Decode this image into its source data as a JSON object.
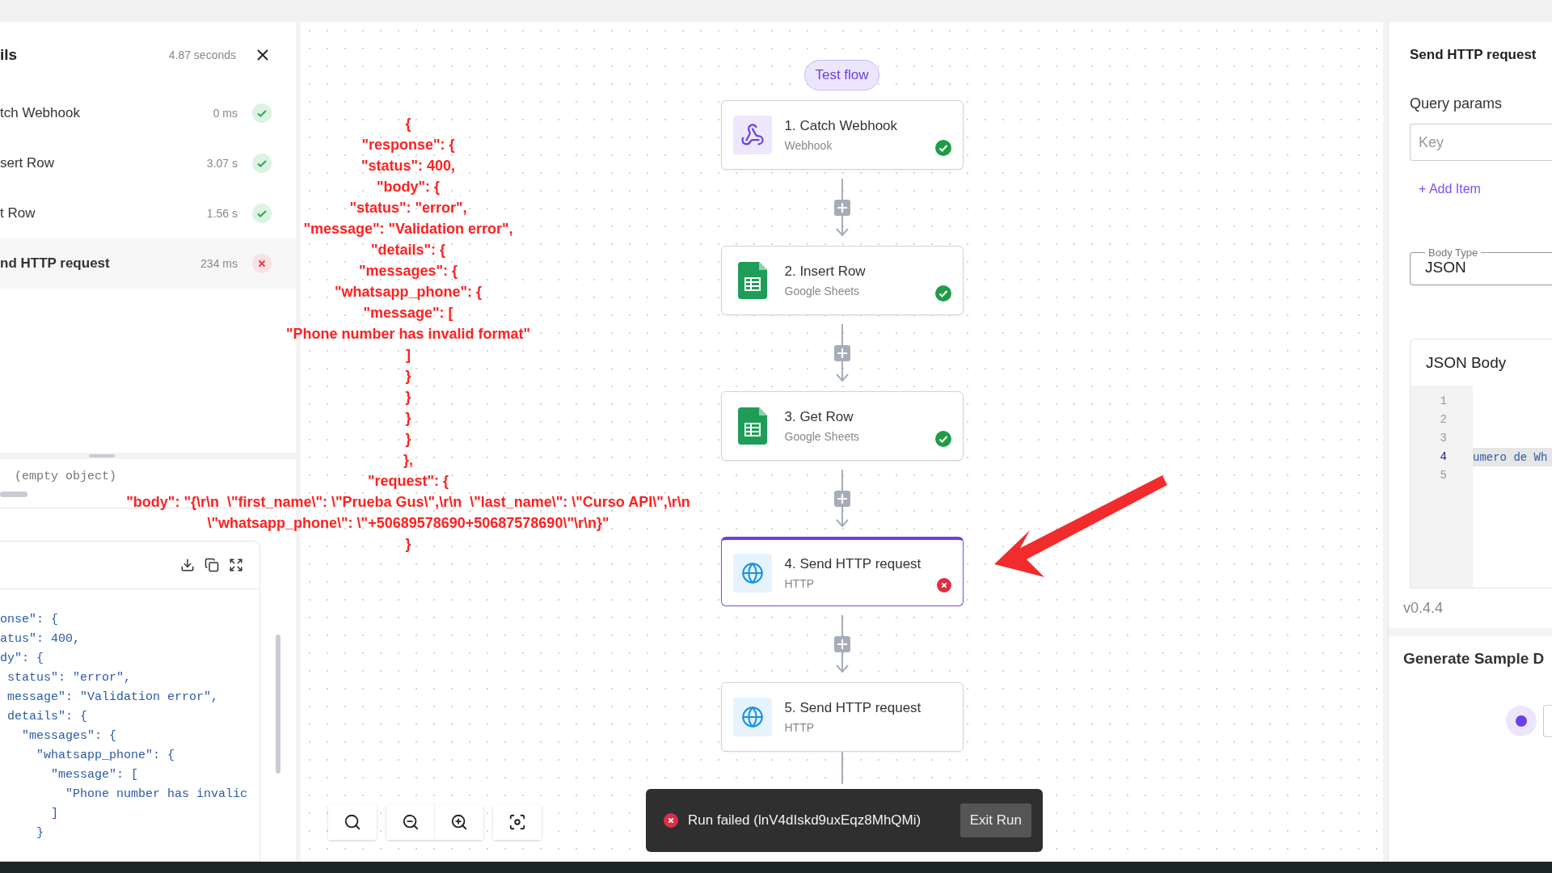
{
  "run_details": {
    "title": "ils",
    "duration": "4.87 seconds",
    "steps": [
      {
        "name": "tch Webhook",
        "time": "0 ms",
        "failed": false,
        "selected": false
      },
      {
        "name": "sert Row",
        "time": "3.07 s",
        "failed": false,
        "selected": false
      },
      {
        "name": "t Row",
        "time": "1.56 s",
        "failed": false,
        "selected": false
      },
      {
        "name": "nd HTTP request",
        "time": "234 ms",
        "failed": true,
        "selected": true
      }
    ],
    "input_preview": "(empty object)",
    "output_lines": [
      "onse\": {",
      "atus\": 400,",
      "dy\": {",
      " status\": \"error\",",
      " message\": \"Validation error\",",
      " details\": {",
      "   \"messages\": {",
      "     \"whatsapp_phone\": {",
      "       \"message\": [",
      "         \"Phone number has invalic",
      "       ]",
      "     }"
    ]
  },
  "canvas": {
    "test_button": "Test flow",
    "nodes": [
      {
        "title": "1. Catch Webhook",
        "subtitle": "Webhook",
        "kind": "webhook",
        "passed": true,
        "failed": false,
        "selected": false
      },
      {
        "title": "2. Insert Row",
        "subtitle": "Google Sheets",
        "kind": "sheets",
        "passed": true,
        "failed": false,
        "selected": false
      },
      {
        "title": "3. Get Row",
        "subtitle": "Google Sheets",
        "kind": "sheets",
        "passed": true,
        "failed": false,
        "selected": false
      },
      {
        "title": "4. Send HTTP request",
        "subtitle": "HTTP",
        "kind": "http",
        "passed": false,
        "failed": true,
        "selected": true
      },
      {
        "title": "5. Send HTTP request",
        "subtitle": "HTTP",
        "kind": "http",
        "passed": false,
        "failed": false,
        "selected": false
      }
    ],
    "toast": {
      "message": "Run failed (lnV4dIskd9uxEqz8MhQMi)",
      "button": "Exit Run"
    }
  },
  "annotation": {
    "lines": [
      "{",
      "\"response\": {",
      "\"status\": 400,",
      "\"body\": {",
      "\"status\": \"error\",",
      "\"message\": \"Validation error\",",
      "\"details\": {",
      "\"messages\": {",
      "\"whatsapp_phone\": {",
      "\"message\": [",
      "\"Phone number has invalid format\"",
      "]",
      "}",
      "}",
      "}",
      "}",
      "},",
      "\"request\": {",
      "\"body\": \"{\\r\\n  \\\"first_name\\\": \\\"Prueba Gus\\\",\\r\\n  \\\"last_name\\\": \\\"Curso API\\\",\\r\\n",
      "\\\"whatsapp_phone\\\": \\\"+50689578690+50687578690\\\"\\r\\n}\"",
      "}"
    ]
  },
  "settings": {
    "title": "Send HTTP request",
    "query_label": "Query params",
    "key_placeholder": "Key",
    "add_item": "+ Add Item",
    "body_type_label": "Body Type",
    "body_type": "JSON",
    "json_body_title": "JSON Body",
    "editor_lines": [
      {
        "number": "1",
        "active": false
      },
      {
        "number": "2",
        "active": false
      },
      {
        "number": "3",
        "active": false
      },
      {
        "number": "4",
        "active": true,
        "text": "umero de Wh"
      },
      {
        "number": "5",
        "active": false
      }
    ],
    "version": "v0.4.4",
    "sample_title": "Generate Sample D",
    "radio_selected": true
  }
}
